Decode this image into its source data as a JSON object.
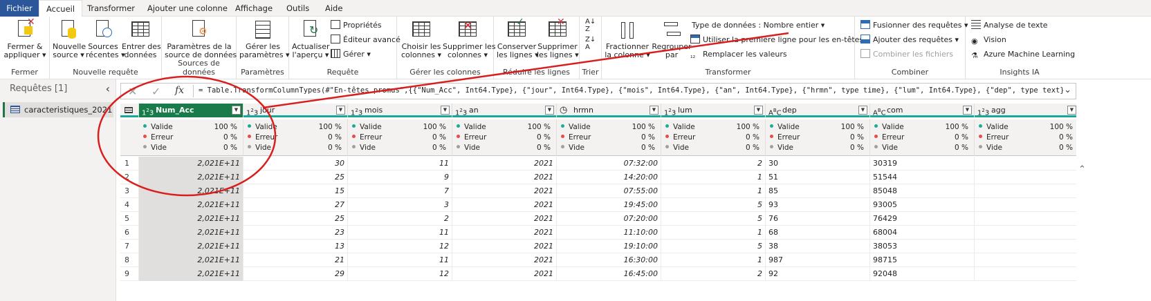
{
  "tabs": [
    "Fichier",
    "Accueil",
    "Transformer",
    "Ajouter une colonne",
    "Affichage",
    "Outils",
    "Aide"
  ],
  "ribbon": {
    "groups": {
      "fermer": "Fermer",
      "nouvelle_requete": "Nouvelle requête",
      "sources": "Sources de données",
      "parametres": "Paramètres",
      "requete": "Requête",
      "gerer_colonnes": "Gérer les colonnes",
      "reduire": "Réduire les lignes",
      "trier": "Trier",
      "transformer": "Transformer",
      "combiner": "Combiner",
      "insights": "Insights IA"
    },
    "buttons": {
      "fermer_appliquer": "Fermer &\nappliquer ▾",
      "nouvelle_source": "Nouvelle\nsource ▾",
      "sources_recentes": "Sources\nrécentes ▾",
      "entrer_donnees": "Entrer des\ndonnées",
      "parametres_source": "Paramètres de la\nsource de données",
      "gerer_parametres": "Gérer les\nparamètres ▾",
      "actualiser": "Actualiser\nl'aperçu ▾",
      "proprietes": "Propriétés",
      "editeur_avance": "Éditeur avancé",
      "gerer": "Gérer ▾",
      "choisir_colonnes": "Choisir les\ncolonnes ▾",
      "supprimer_colonnes": "Supprimer les\ncolonnes ▾",
      "conserver_lignes": "Conserver\nles lignes ▾",
      "supprimer_lignes": "Supprimer\nles lignes ▾",
      "fractionner": "Fractionner\nla colonne ▾",
      "regrouper": "Regrouper\npar",
      "type_donnees": "Type de données : Nombre entier ▾",
      "premiere_ligne": "Utiliser la première ligne pour les en-têtes ▾",
      "remplacer": "Remplacer les valeurs",
      "fusionner": "Fusionner des requêtes ▾",
      "ajouter_requetes": "Ajouter des requêtes ▾",
      "combiner_fichiers": "Combiner les fichiers",
      "analyse_texte": "Analyse de texte",
      "vision": "Vision",
      "azure_ml": "Azure Machine Learning"
    }
  },
  "queries_pane": {
    "title": "Requêtes [1]",
    "items": [
      "caracteristiques_2021"
    ]
  },
  "formula": {
    "prefix": "= Table.TransformColumnTypes(#\"En-têtes promus\",{{",
    "body": "\"Num_Acc\", Int64.Type}, {\"jour\", Int64.Type}, {\"mois\", Int64.Type}, {\"an\", Int64.Type}, {\"hrmn\", type time}, {\"lum\", Int64.Type}, {\"dep\", type text},"
  },
  "columns": [
    {
      "name": "Num_Acc",
      "type_icon": "1²3",
      "align": "num"
    },
    {
      "name": "jour",
      "type_icon": "1²3",
      "align": "num"
    },
    {
      "name": "mois",
      "type_icon": "1²3",
      "align": "num"
    },
    {
      "name": "an",
      "type_icon": "1²3",
      "align": "num"
    },
    {
      "name": "hrmn",
      "type_icon": "clock",
      "align": "num"
    },
    {
      "name": "lum",
      "type_icon": "1²3",
      "align": "num"
    },
    {
      "name": "dep",
      "type_icon": "ABC",
      "align": "text"
    },
    {
      "name": "com",
      "type_icon": "ABC",
      "align": "text"
    },
    {
      "name": "agg",
      "type_icon": "1²3",
      "align": "num"
    }
  ],
  "quality": {
    "labels": [
      "Valide",
      "Erreur",
      "Vide"
    ],
    "values": [
      "100 %",
      "0 %",
      "0 %"
    ],
    "colors": [
      "#1aab9b",
      "#e84a4a",
      "#a19f9d"
    ]
  },
  "rows": [
    [
      "1",
      "2,021E+11",
      "30",
      "11",
      "2021",
      "07:32:00",
      "2",
      "30",
      "30319",
      ""
    ],
    [
      "2",
      "2,021E+11",
      "25",
      "9",
      "2021",
      "14:20:00",
      "1",
      "51",
      "51544",
      ""
    ],
    [
      "3",
      "2,021E+11",
      "15",
      "7",
      "2021",
      "07:55:00",
      "1",
      "85",
      "85048",
      ""
    ],
    [
      "4",
      "2,021E+11",
      "27",
      "3",
      "2021",
      "19:45:00",
      "5",
      "93",
      "93005",
      ""
    ],
    [
      "5",
      "2,021E+11",
      "25",
      "2",
      "2021",
      "07:20:00",
      "5",
      "76",
      "76429",
      ""
    ],
    [
      "6",
      "2,021E+11",
      "23",
      "11",
      "2021",
      "11:10:00",
      "1",
      "68",
      "68004",
      ""
    ],
    [
      "7",
      "2,021E+11",
      "13",
      "12",
      "2021",
      "19:10:00",
      "5",
      "38",
      "38053",
      ""
    ],
    [
      "8",
      "2,021E+11",
      "21",
      "11",
      "2021",
      "16:30:00",
      "1",
      "987",
      "98715",
      ""
    ],
    [
      "9",
      "2,021E+11",
      "29",
      "12",
      "2021",
      "16:45:00",
      "2",
      "92",
      "92048",
      ""
    ]
  ],
  "colors": {
    "file_tab": "#2b579a",
    "selected_header": "#1a7b4a",
    "quality_bar": "#15a99a",
    "annotation": "#d91e1e"
  }
}
